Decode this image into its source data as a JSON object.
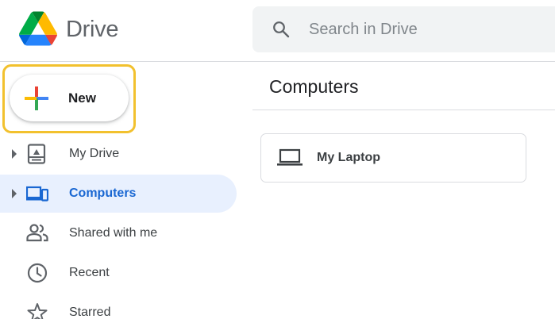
{
  "app": {
    "name": "Drive",
    "brand_colors": {
      "green": "#0f9d58",
      "blue": "#4285f4",
      "yellow": "#fbbc04",
      "red": "#ea4335"
    }
  },
  "search": {
    "placeholder": "Search in Drive",
    "icon": "search-icon"
  },
  "new_button": {
    "label": "New",
    "icon": "plus-icon",
    "highlight_color": "#f2c12e"
  },
  "sidebar": {
    "items": [
      {
        "label": "My Drive",
        "icon": "my-drive-icon",
        "expandable": true,
        "active": false
      },
      {
        "label": "Computers",
        "icon": "computers-icon",
        "expandable": true,
        "active": true
      },
      {
        "label": "Shared with me",
        "icon": "shared-with-me-icon",
        "expandable": false,
        "active": false
      },
      {
        "label": "Recent",
        "icon": "recent-clock-icon",
        "expandable": false,
        "active": false
      },
      {
        "label": "Starred",
        "icon": "star-icon",
        "expandable": false,
        "active": false
      }
    ],
    "active_color": "#1967d2",
    "active_background": "#e8f0fe"
  },
  "main": {
    "title": "Computers",
    "computers": [
      {
        "name": "My Laptop",
        "icon": "laptop-icon"
      }
    ]
  }
}
